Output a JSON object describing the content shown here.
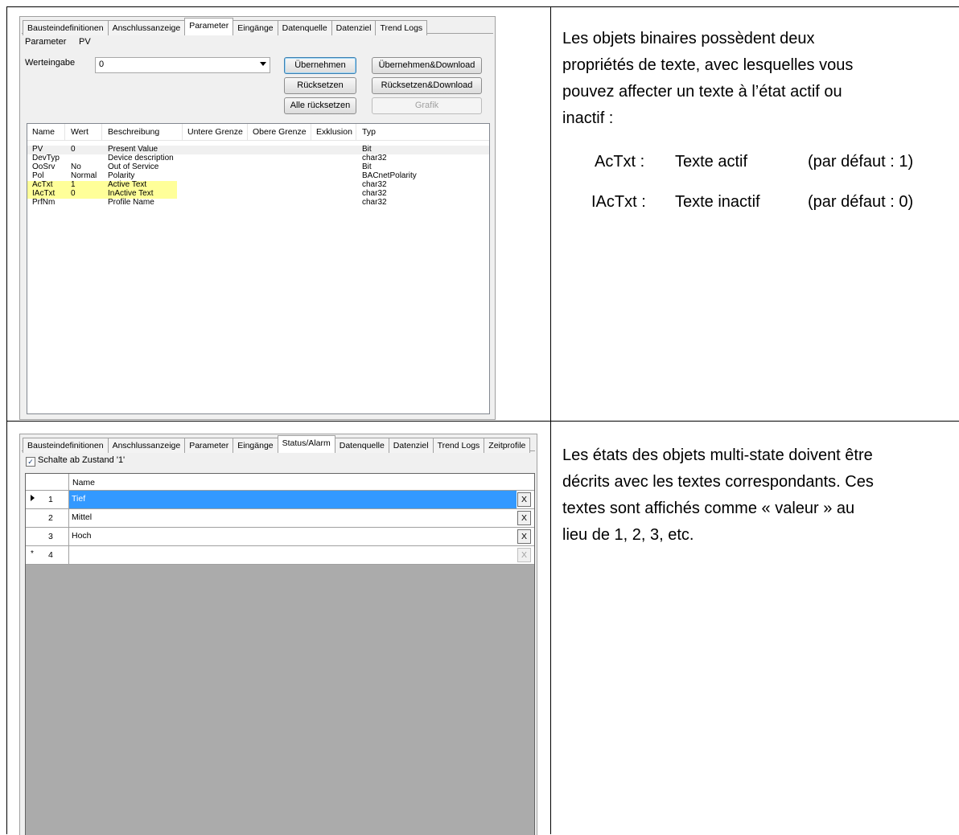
{
  "panel1": {
    "tabs": [
      "Bausteindefinitionen",
      "Anschlussanzeige",
      "Parameter",
      "Eingänge",
      "Datenquelle",
      "Datenziel",
      "Trend Logs"
    ],
    "param_label": "Parameter",
    "param_value": "PV",
    "werteingabe_label": "Werteingabe",
    "werteingabe_value": "0",
    "buttons": {
      "uebernehmen": "Übernehmen",
      "ruecksetzen": "Rücksetzen",
      "alle_ruecksetzen": "Alle rücksetzen",
      "uebernehmen_download": "Übernehmen&Download",
      "ruecksetzen_download": "Rücksetzen&Download",
      "grafik": "Grafik"
    },
    "columns": [
      "Name",
      "Wert",
      "Beschreibung",
      "Untere Grenze",
      "Obere Grenze",
      "Exklusion",
      "Typ"
    ],
    "rows": [
      {
        "name": "PV",
        "wert": "0",
        "beschreibung": "Present Value",
        "typ": "Bit"
      },
      {
        "name": "DevTyp",
        "wert": "",
        "beschreibung": "Device description",
        "typ": "char32"
      },
      {
        "name": "OoSrv",
        "wert": "No",
        "beschreibung": "Out of Service",
        "typ": "Bit"
      },
      {
        "name": "Pol",
        "wert": "Normal",
        "beschreibung": "Polarity",
        "typ": "BACnetPolarity"
      },
      {
        "name": "AcTxt",
        "wert": "1",
        "beschreibung": "Active Text",
        "typ": "char32"
      },
      {
        "name": "IAcTxt",
        "wert": "0",
        "beschreibung": "InActive Text",
        "typ": "char32"
      },
      {
        "name": "PrfNm",
        "wert": "",
        "beschreibung": "Profile Name",
        "typ": "char32"
      }
    ]
  },
  "text1": {
    "lines": [
      "Les objets binaires possèdent deux",
      "propriétés de texte, avec lesquelles vous",
      "pouvez affecter un texte à l’état actif ou",
      "inactif :"
    ],
    "defs": [
      {
        "key": "AcTxt :",
        "label": "Texte actif",
        "default": "(par défaut : 1)"
      },
      {
        "key": "IAcTxt :",
        "label": "Texte inactif",
        "default": "(par défaut : 0)"
      }
    ]
  },
  "panel2": {
    "tabs": [
      "Bausteindefinitionen",
      "Anschlussanzeige",
      "Parameter",
      "Eingänge",
      "Status/Alarm",
      "Datenquelle",
      "Datenziel",
      "Trend Logs",
      "Zeitprofile"
    ],
    "checkbox_label": "Schalte ab Zustand '1'",
    "column_name": "Name",
    "rows": [
      {
        "num": "1",
        "name": "Tief",
        "x": "X"
      },
      {
        "num": "2",
        "name": "Mittel",
        "x": "X"
      },
      {
        "num": "3",
        "name": "Hoch",
        "x": "X"
      },
      {
        "num": "4",
        "name": "",
        "x": "X"
      }
    ]
  },
  "text2": {
    "lines": [
      "Les états des objets multi-state doivent être",
      "décrits avec les textes correspondants. Ces",
      "textes sont affichés comme « valeur » au",
      "lieu de 1, 2, 3, etc."
    ]
  }
}
